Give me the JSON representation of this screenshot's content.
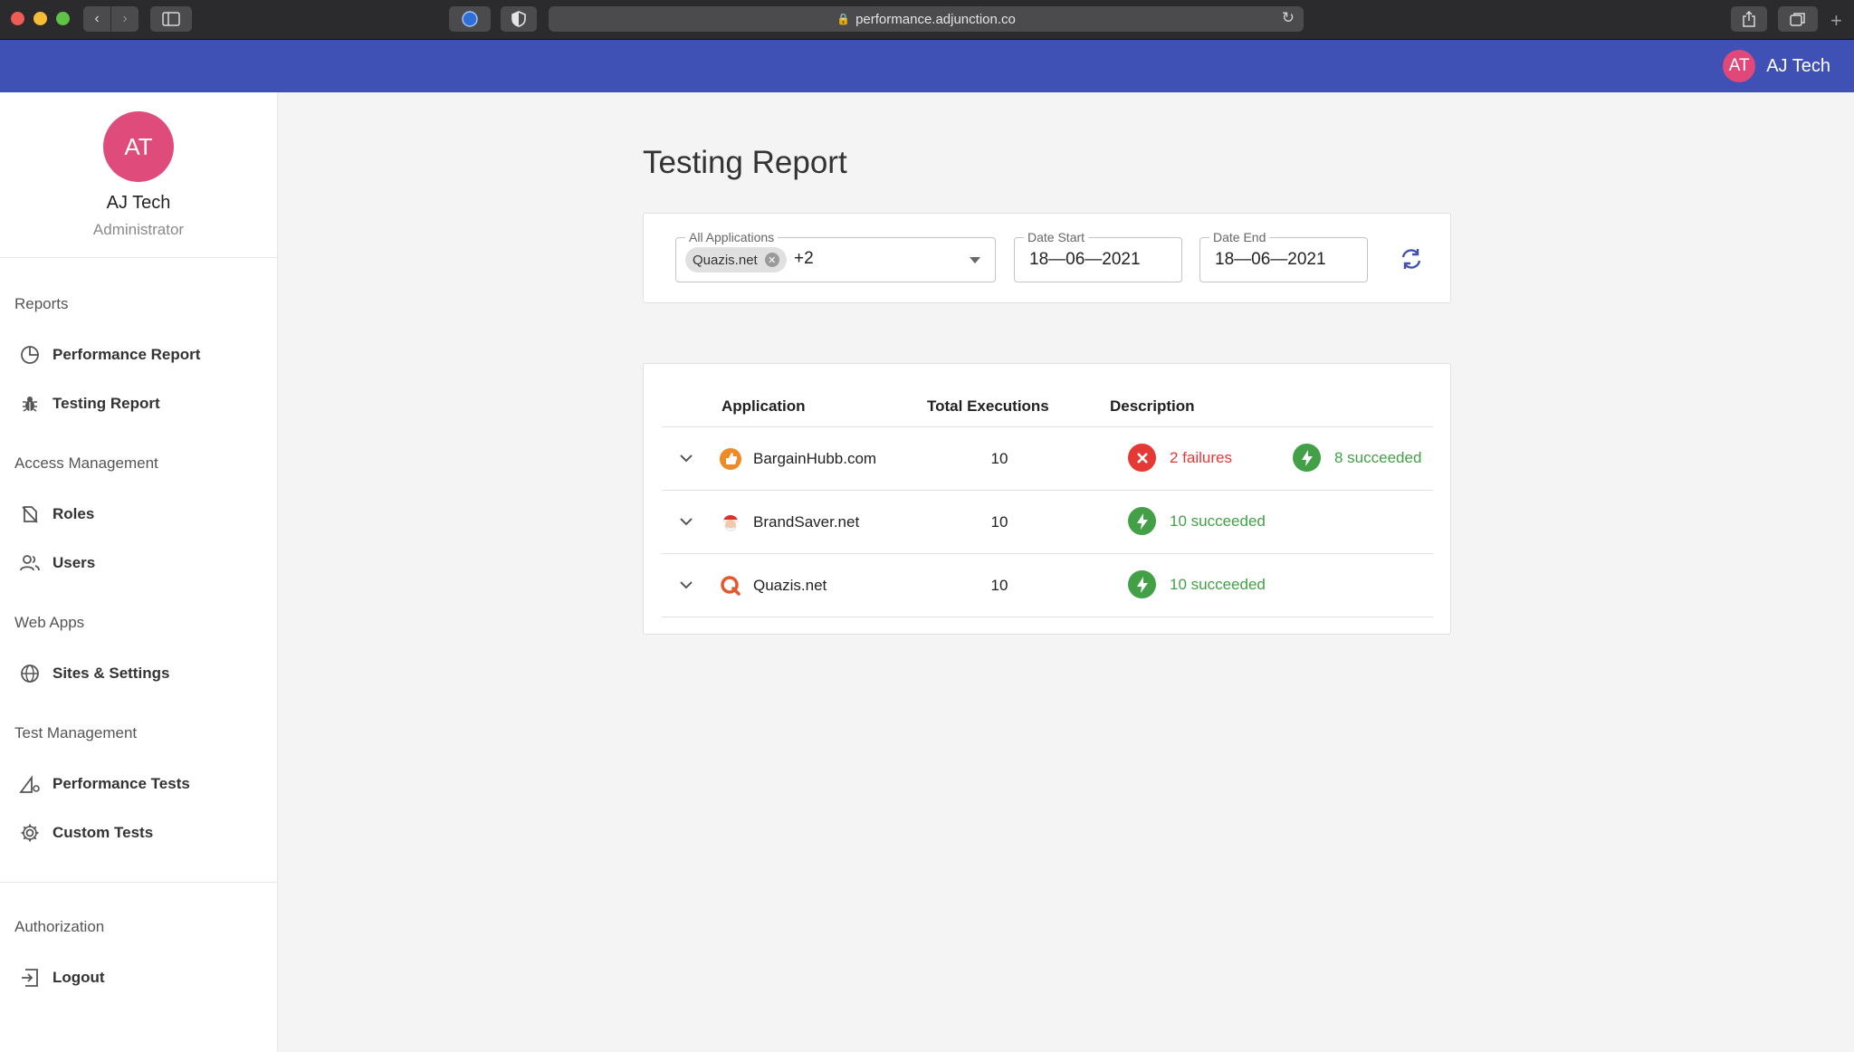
{
  "browser": {
    "url": "performance.adjunction.co"
  },
  "header": {
    "user_initials": "AT",
    "user_name": "AJ Tech"
  },
  "sidebar": {
    "profile": {
      "initials": "AT",
      "name": "AJ Tech",
      "role": "Administrator"
    },
    "sections": [
      {
        "title": "Reports",
        "items": [
          {
            "label": "Performance Report",
            "icon": "pie-chart-icon"
          },
          {
            "label": "Testing Report",
            "icon": "bug-icon"
          }
        ]
      },
      {
        "title": "Access Management",
        "items": [
          {
            "label": "Roles",
            "icon": "badge-icon"
          },
          {
            "label": "Users",
            "icon": "users-icon"
          }
        ]
      },
      {
        "title": "Web Apps",
        "items": [
          {
            "label": "Sites & Settings",
            "icon": "globe-icon"
          }
        ]
      },
      {
        "title": "Test Management",
        "items": [
          {
            "label": "Performance Tests",
            "icon": "ruler-gear-icon"
          },
          {
            "label": "Custom Tests",
            "icon": "gear-icon"
          }
        ]
      },
      {
        "title": "Authorization",
        "items": [
          {
            "label": "Logout",
            "icon": "logout-icon"
          }
        ]
      }
    ]
  },
  "main": {
    "title": "Testing Report",
    "filters": {
      "applications": {
        "label": "All Applications",
        "chip": "Quazis.net",
        "more": "+2"
      },
      "date_start": {
        "label": "Date Start",
        "value": "18—06—2021"
      },
      "date_end": {
        "label": "Date End",
        "value": "18—06—2021"
      }
    },
    "table": {
      "headers": {
        "application": "Application",
        "total": "Total Executions",
        "description": "Description"
      },
      "rows": [
        {
          "name": "BargainHubb.com",
          "total": "10",
          "failures": "2 failures",
          "succeeded": "8 succeeded",
          "icon": "thumbs-up-logo-icon"
        },
        {
          "name": "BrandSaver.net",
          "total": "10",
          "failures": "",
          "succeeded": "10 succeeded",
          "icon": "santa-logo-icon"
        },
        {
          "name": "Quazis.net",
          "total": "10",
          "failures": "",
          "succeeded": "10 succeeded",
          "icon": "q-logo-icon"
        }
      ]
    }
  },
  "colors": {
    "primary": "#3f51b5",
    "avatar": "#e0487a",
    "failure": "#e53935",
    "success": "#43a047"
  }
}
